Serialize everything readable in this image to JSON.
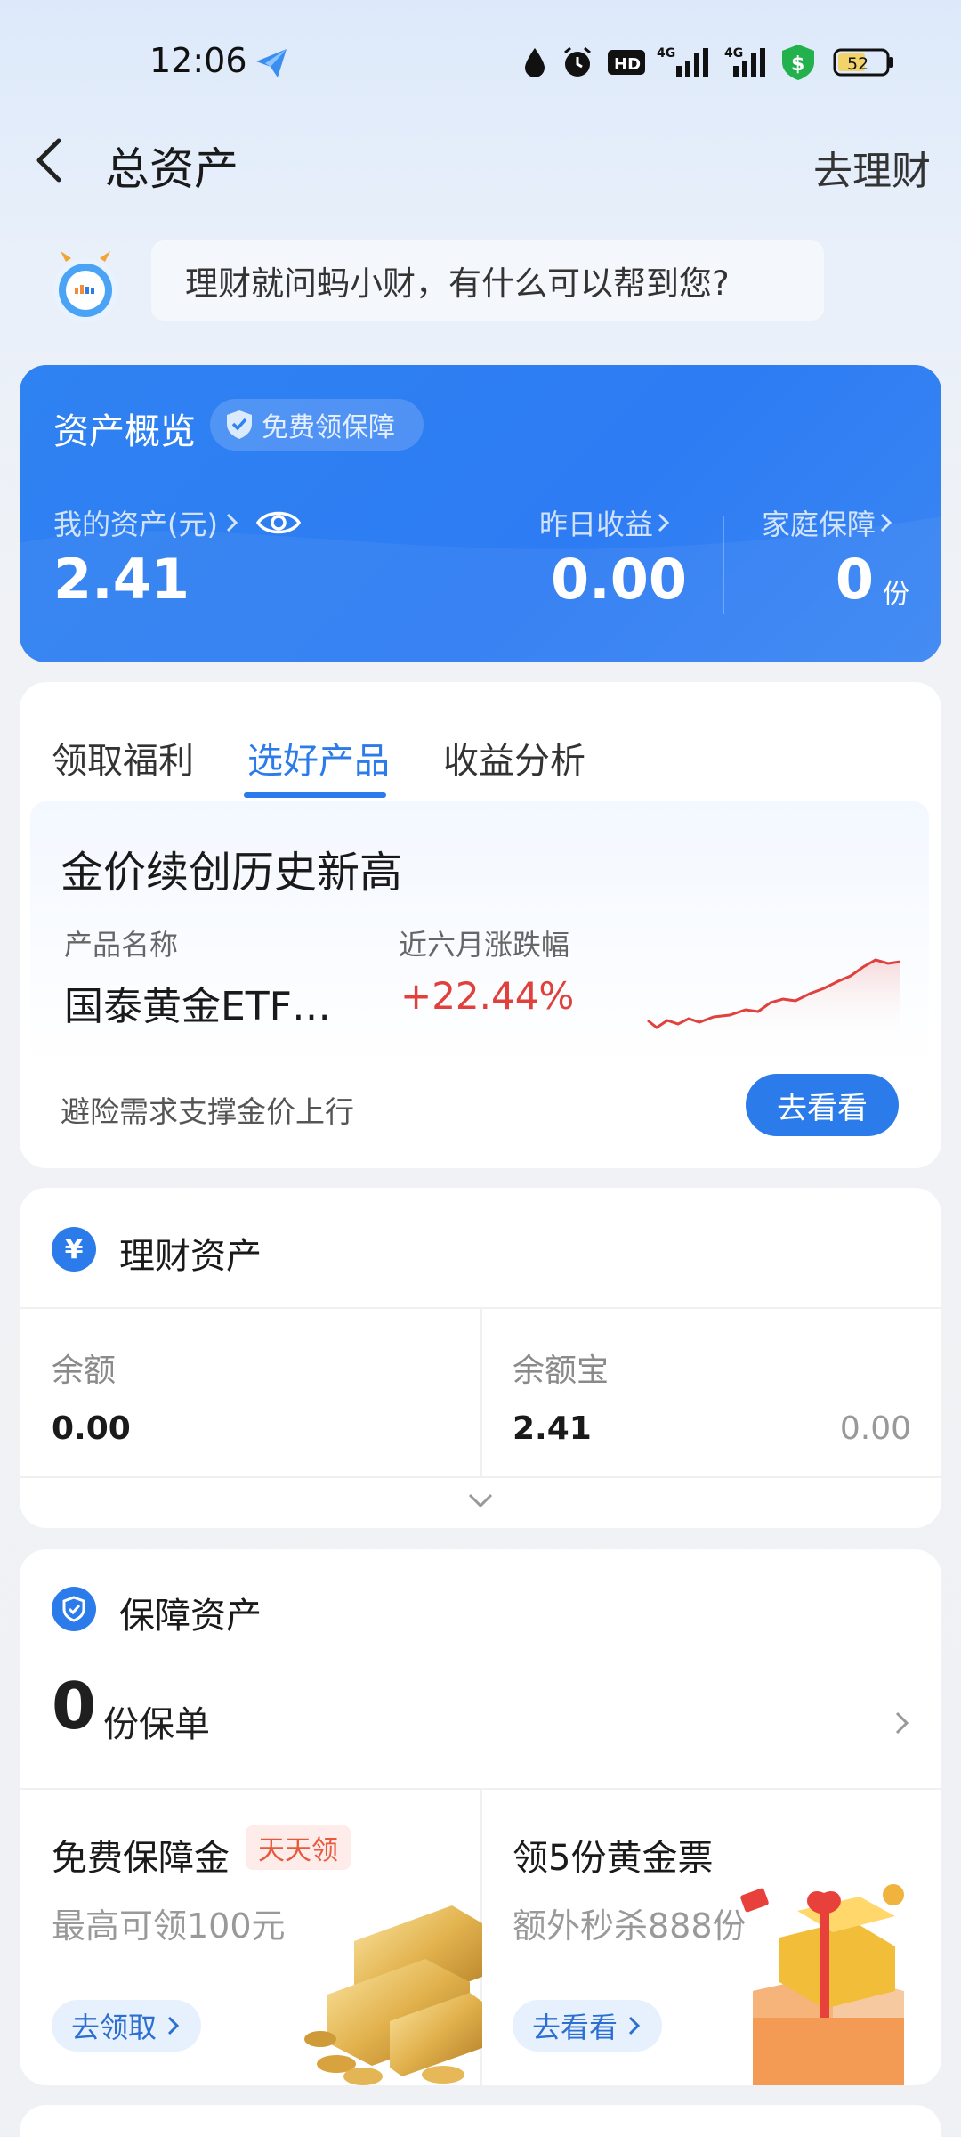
{
  "status_bar": {
    "time": "12:06",
    "battery": "52"
  },
  "header": {
    "title": "总资产",
    "right_action": "去理财"
  },
  "assistant": {
    "prompt": "理财就问蚂小财，有什么可以帮到您?"
  },
  "overview": {
    "title": "资产概览",
    "badge": "免费领保障",
    "my_assets_label": "我的资产(元)",
    "my_assets_value": "2.41",
    "yesterday_label": "昨日收益",
    "yesterday_value": "0.00",
    "family_label": "家庭保障",
    "family_value": "0",
    "family_unit": "份"
  },
  "tabs": [
    "领取福利",
    "选好产品",
    "收益分析"
  ],
  "promo": {
    "title": "金价续创历史新高",
    "name_label": "产品名称",
    "change_label": "近六月涨跌幅",
    "product_name": "国泰黄金ETF…",
    "change": "+22.44%",
    "footer": "避险需求支撑金价上行",
    "button": "去看看"
  },
  "wealth": {
    "icon": "¥",
    "title": "理财资产",
    "balance_label": "余额",
    "balance_value": "0.00",
    "yeb_label": "余额宝",
    "yeb_value": "2.41",
    "yeb_gain": "0.00"
  },
  "insurance": {
    "title": "保障资产",
    "count": "0",
    "count_unit": "份保单",
    "card1_title": "免费保障金",
    "card1_tag": "天天领",
    "card1_sub": "最高可领100元",
    "card1_btn": "去领取",
    "card2_title": "领5份黄金票",
    "card2_sub": "额外秒杀888份",
    "card2_btn": "去看看"
  },
  "colors": {
    "primary": "#2c7bea",
    "card_blue": "#2f82f2",
    "red": "#e0413c"
  }
}
